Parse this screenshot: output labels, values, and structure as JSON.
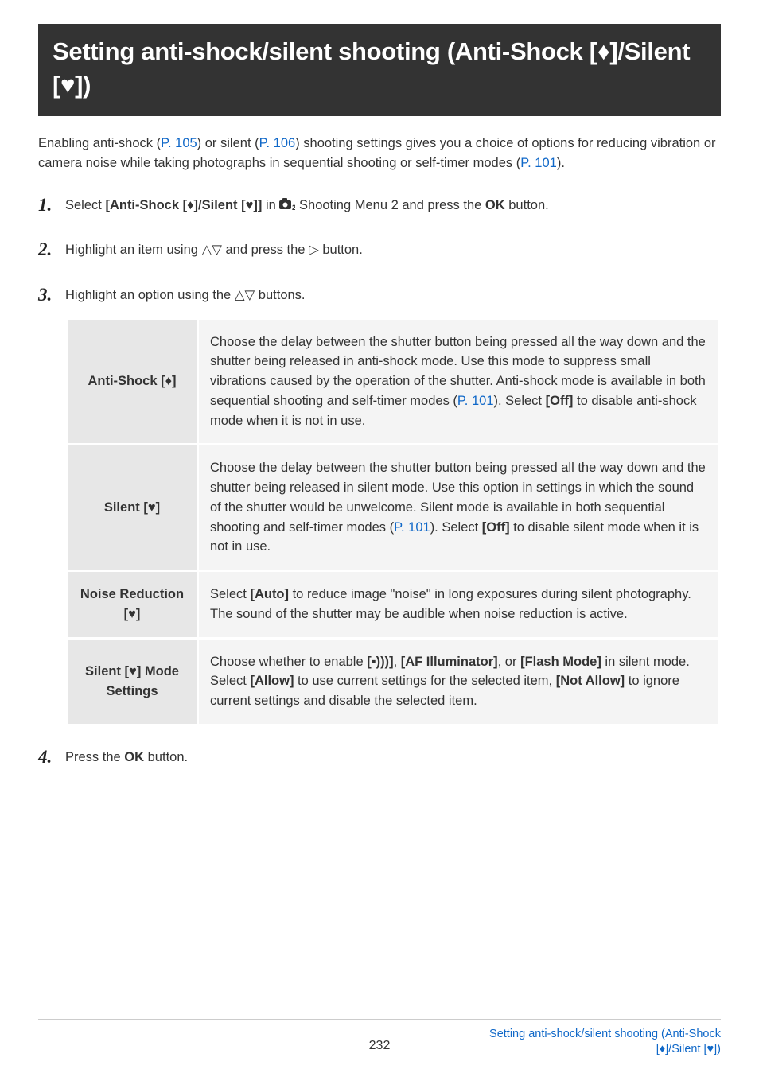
{
  "title": {
    "full": "Setting anti-shock/silent shooting (Anti-Shock [♦]/Silent [♥])"
  },
  "intro": {
    "t1": "Enabling anti-shock (",
    "l1": "P. 105",
    "t2": ") or silent (",
    "l2": "P. 106",
    "t3": ") shooting settings gives you a choice of options for reducing vibration or camera noise while taking photographs in sequential shooting or self-timer modes (",
    "l3": "P. 101",
    "t4": ")."
  },
  "steps": {
    "s1": {
      "num": "1.",
      "t1": "Select ",
      "b1": "[Anti-Shock [♦]/Silent [♥]]",
      "t2": " in ",
      "t3": " Shooting Menu 2 and press the ",
      "b2": "OK",
      "t4": " button."
    },
    "s2": {
      "num": "2.",
      "t1": "Highlight an item using ",
      "sym1": "△▽",
      "t2": " and press the ",
      "sym2": "▷",
      "t3": " button."
    },
    "s3": {
      "num": "3.",
      "t1": "Highlight an option using the ",
      "sym1": "△▽",
      "t2": " buttons."
    },
    "s4": {
      "num": "4.",
      "t1": "Press the ",
      "b1": "OK",
      "t2": " button."
    }
  },
  "table": {
    "r1": {
      "head": "Anti-Shock [♦]",
      "c1": "Choose the delay between the shutter button being pressed all the way down and the shutter being released in anti-shock mode. Use this mode to suppress small vibrations caused by the operation of the shutter. Anti-shock mode is available in both sequential shooting and self-timer modes (",
      "link": "P. 101",
      "c2": "). Select ",
      "b": "[Off]",
      "c3": " to disable anti-shock mode when it is not in use."
    },
    "r2": {
      "head": "Silent [♥]",
      "c1": "Choose the delay between the shutter button being pressed all the way down and the shutter being released in silent mode. Use this option in settings in which the sound of the shutter would be unwelcome. Silent mode is available in both sequential shooting and self-timer modes (",
      "link": "P. 101",
      "c2": "). Select ",
      "b": "[Off]",
      "c3": " to disable silent mode when it is not in use."
    },
    "r3": {
      "head": "Noise Reduction [♥]",
      "c1": "Select ",
      "b": "[Auto]",
      "c2": " to reduce image \"noise\" in long exposures during silent photography. The sound of the shutter may be audible when noise reduction is active."
    },
    "r4": {
      "head": "Silent [♥] Mode Settings",
      "c1": "Choose whether to enable ",
      "b1": "[",
      "b1b": "]",
      "c2": ", ",
      "b2": "[AF Illuminator]",
      "c3": ", or ",
      "b3": "[Flash Mode]",
      "c4": " in silent mode.",
      "c5": "Select ",
      "b4": "[Allow]",
      "c6": " to use current settings for the selected item, ",
      "b5": "[Not Allow]",
      "c7": " to ignore current settings and disable the selected item."
    }
  },
  "footer": {
    "page": "232",
    "link1": "Setting anti-shock/silent shooting (Anti-Shock",
    "link2": "[♦]/Silent [♥])"
  }
}
